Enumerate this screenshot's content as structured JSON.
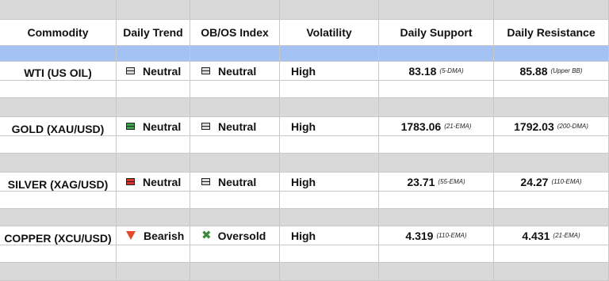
{
  "header": {
    "col0": "Commodity",
    "col1": "Daily Trend",
    "col2": "OB/OS Index",
    "col3": "Volatility",
    "col4": "Daily Support",
    "col5": "Daily Resistance"
  },
  "rows": [
    {
      "commodity": "WTI (US OIL)",
      "trend": "Neutral",
      "trend_icon": "neutral-bars-gray-icon",
      "obos": "Neutral",
      "obos_icon": "neutral-bars-icon",
      "volatility": "High",
      "support": "83.18",
      "support_note": "(5-DMA)",
      "resistance": "85.88",
      "resistance_note": "(Upper BB)"
    },
    {
      "commodity": "GOLD (XAU/USD)",
      "trend": "Neutral",
      "trend_icon": "neutral-bars-green-icon",
      "obos": "Neutral",
      "obos_icon": "neutral-bars-icon",
      "volatility": "High",
      "support": "1783.06",
      "support_note": "(21-EMA)",
      "resistance": "1792.03",
      "resistance_note": "(200-DMA)"
    },
    {
      "commodity": "SILVER (XAG/USD)",
      "trend": "Neutral",
      "trend_icon": "neutral-bars-red-icon",
      "obos": "Neutral",
      "obos_icon": "neutral-bars-icon",
      "volatility": "High",
      "support": "23.71",
      "support_note": "(55-EMA)",
      "resistance": "24.27",
      "resistance_note": "(110-EMA)"
    },
    {
      "commodity": "COPPER (XCU/USD)",
      "trend": "Bearish",
      "trend_icon": "bearish-triangle-down-icon",
      "obos": "Oversold",
      "obos_icon": "oversold-x-icon",
      "volatility": "High",
      "support": "4.319",
      "support_note": "(110-EMA)",
      "resistance": "4.431",
      "resistance_note": "(21-EMA)"
    }
  ],
  "colors": {
    "header_band": "#d9d9d9",
    "separator_gray": "#d9d9d9",
    "blue_band": "#a4c2f4",
    "bearish": "#e04b2e",
    "oversold": "#3b8a3b",
    "green_bar": "#3fa34d",
    "red_bar": "#d6342c"
  }
}
